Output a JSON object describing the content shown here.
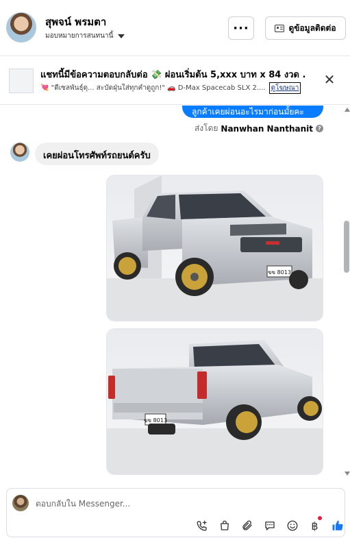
{
  "header": {
    "user_name": "สุพจน์ พรมตา",
    "assign_label": "มอบหมายการสนทนานี้",
    "more_label": "···",
    "contact_label": "ดูข้อมูลติดต่อ"
  },
  "ad": {
    "title": "แชทนี้มีข้อความตอบกลับต่อ 💸 ผ่อนเริ่มต้น 5,xxx บาท x 84 งวด .",
    "subtitle": "💘 \"ดีเซลพันธุ์ดุ... สะบัดฝุ่นใส่ทุกคำดูถูก!\" 🚗 D-Max Spacecab SLX 2....",
    "tag": "ดูโฆษณา",
    "close_label": "✕"
  },
  "conversation": {
    "outgoing_text": "ลูกค้าเคยผ่อนอะไรมาก่อนมั้ยคะ",
    "sent_by_prefix": "ส่งโดย",
    "sent_by_name": "Nanwhan Nanthanit",
    "info_icon": "?",
    "incoming_text": "เคยผ่อนโทรศัพท์รถยนต์ครับ",
    "plate_text": "ขข 8013"
  },
  "composer": {
    "placeholder": "ตอบกลับใน Messenger...",
    "baht_symbol": "฿"
  },
  "colors": {
    "outgoing_bubble": "#0a7cff",
    "incoming_bubble": "#f0f0f0",
    "like": "#1877f2",
    "notification_dot": "#e41e3f"
  },
  "icons": [
    "chevron-down-icon",
    "more-icon",
    "contact-card-icon",
    "close-icon",
    "info-icon",
    "phone-add-icon",
    "bag-icon",
    "paperclip-icon",
    "chat-icon",
    "emoji-icon",
    "baht-icon",
    "thumbs-up-icon"
  ]
}
